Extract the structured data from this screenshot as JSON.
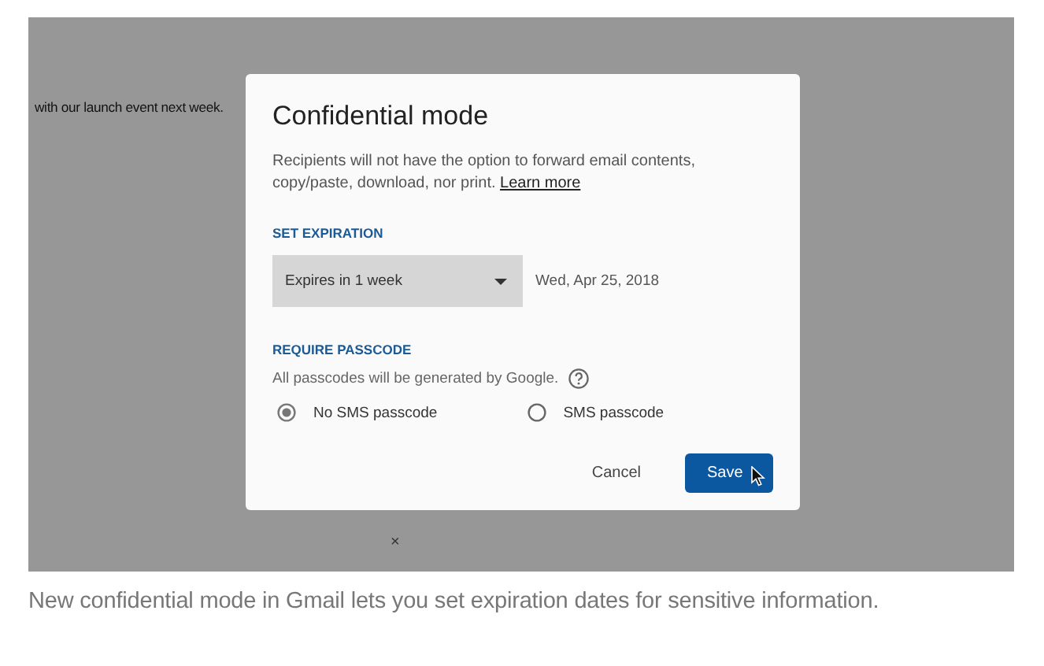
{
  "background": {
    "email_text": "with our launch event next week.",
    "close_glyph": "×"
  },
  "dialog": {
    "title": "Confidential mode",
    "description": "Recipients will not have the option to forward email contents, copy/paste, download, nor print.",
    "learn_more": "Learn more",
    "expiration": {
      "heading": "SET EXPIRATION",
      "value": "Expires in 1 week",
      "date": "Wed, Apr 25, 2018"
    },
    "passcode": {
      "heading": "REQUIRE PASSCODE",
      "help": "All passcodes will be generated by Google.",
      "options": [
        {
          "label": "No SMS passcode",
          "selected": true
        },
        {
          "label": "SMS passcode",
          "selected": false
        }
      ]
    },
    "buttons": [
      {
        "label": "Cancel",
        "kind": "text"
      },
      {
        "label": "Save",
        "kind": "primary",
        "hovered": true
      }
    ]
  },
  "caption": "New confidential mode in Gmail lets you set expiration dates for sensitive information."
}
